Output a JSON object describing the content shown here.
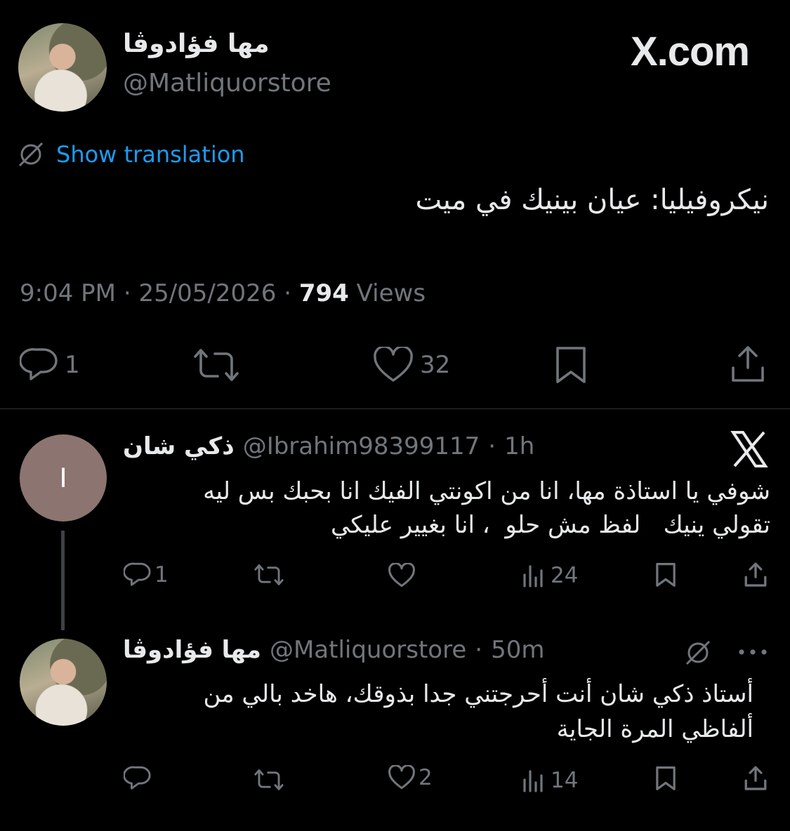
{
  "main_tweet": {
    "author_name": "مها فؤادوڤا",
    "author_handle": "@Matliquorstore",
    "brand": "X.com",
    "show_translation": "Show translation",
    "text": "نيكروفيليا: عيان بينيك في ميت",
    "time": "9:04 PM",
    "date": "25/05/2026",
    "separator": "·",
    "views_count": "794",
    "views_label": "Views",
    "replies": "1",
    "likes": "32"
  },
  "reply_1": {
    "avatar_letter": "I",
    "author_name": "ذكي شان",
    "author_handle": "@Ibrahim98399117",
    "separator": "·",
    "time": "1h",
    "text_line1": "شوفي يا استاذة مها، انا من اكونتي الفيك انا بحبك بس ليه",
    "text_line2": "تقولي ينيك   لفظ مش حلو  ، انا بغيير عليكي",
    "replies": "1",
    "views": "24"
  },
  "reply_2": {
    "author_name": "مها فؤادوڤا",
    "author_handle": "@Matliquorstore",
    "separator": "·",
    "time": "50m",
    "text_line1": "أستاذ ذكي شان أنت أحرجتني جدا بذوقك، هاخد بالي من",
    "text_line2": "ألفاظي المرة الجاية",
    "likes": "2",
    "views": "14"
  },
  "colors": {
    "background": "#000000",
    "text": "#e7e9ea",
    "secondary": "#71767b",
    "link": "#1d9bf0",
    "divider": "#2f3336"
  }
}
